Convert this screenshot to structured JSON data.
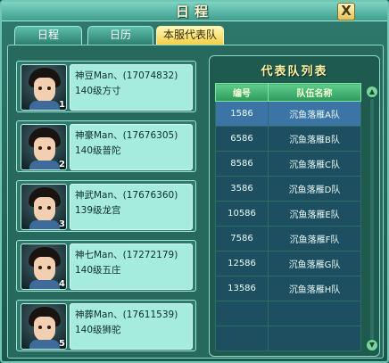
{
  "window": {
    "title": "日程",
    "close_label": "X"
  },
  "tabs": [
    {
      "label": "日程"
    },
    {
      "label": "日历"
    },
    {
      "label": "本服代表队"
    }
  ],
  "members": [
    {
      "name": "神豆Man、(17074832)",
      "level_school": "140级方寸",
      "number": "1"
    },
    {
      "name": "神豪Man、(17676305)",
      "level_school": "140级普陀",
      "number": "2"
    },
    {
      "name": "神武Man、(17676360)",
      "level_school": "139级龙宫",
      "number": "3"
    },
    {
      "name": "神七Man、(17272179)",
      "level_school": "140级五庄",
      "number": "4"
    },
    {
      "name": "神葬Man、(17611539)",
      "level_school": "140级狮驼",
      "number": "5"
    }
  ],
  "team_list": {
    "title": "代表队列表",
    "columns": [
      "编号",
      "队伍名称"
    ],
    "rows": [
      {
        "id": "1586",
        "name": "沉鱼落雁A队"
      },
      {
        "id": "6586",
        "name": "沉鱼落雁B队"
      },
      {
        "id": "8586",
        "name": "沉鱼落雁C队"
      },
      {
        "id": "3586",
        "name": "沉鱼落雁D队"
      },
      {
        "id": "10586",
        "name": "沉鱼落雁E队"
      },
      {
        "id": "7586",
        "name": "沉鱼落雁F队"
      },
      {
        "id": "12586",
        "name": "沉鱼落雁G队"
      },
      {
        "id": "13586",
        "name": "沉鱼落雁H队"
      },
      {
        "id": "",
        "name": ""
      },
      {
        "id": "",
        "name": ""
      }
    ],
    "selected_index": 0
  },
  "icons": {
    "close": "close-icon",
    "scroll_up": "scroll-up-icon",
    "scroll_down": "scroll-down-icon"
  }
}
